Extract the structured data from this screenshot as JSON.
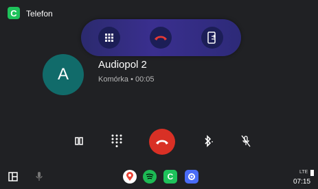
{
  "app": {
    "title": "Telefon",
    "icon_letter": "C",
    "icon_color": "#1ec25b"
  },
  "call_bar": {
    "buttons": [
      "dialpad-icon",
      "end-call-icon",
      "phone-transfer-icon"
    ],
    "end_color": "#d93025"
  },
  "caller": {
    "avatar_letter": "A",
    "avatar_color": "#116b6a",
    "name": "Audiopol 2",
    "status": "Komórka • 00:05"
  },
  "controls": [
    "pause-icon",
    "dialpad-icon",
    "end-call-icon",
    "bluetooth-icon",
    "mic-off-icon"
  ],
  "navbar": {
    "apps": [
      "google-maps-icon",
      "spotify-icon",
      "phone-icon",
      "settings-icon"
    ],
    "time": "07:15",
    "signal": "LTE"
  }
}
